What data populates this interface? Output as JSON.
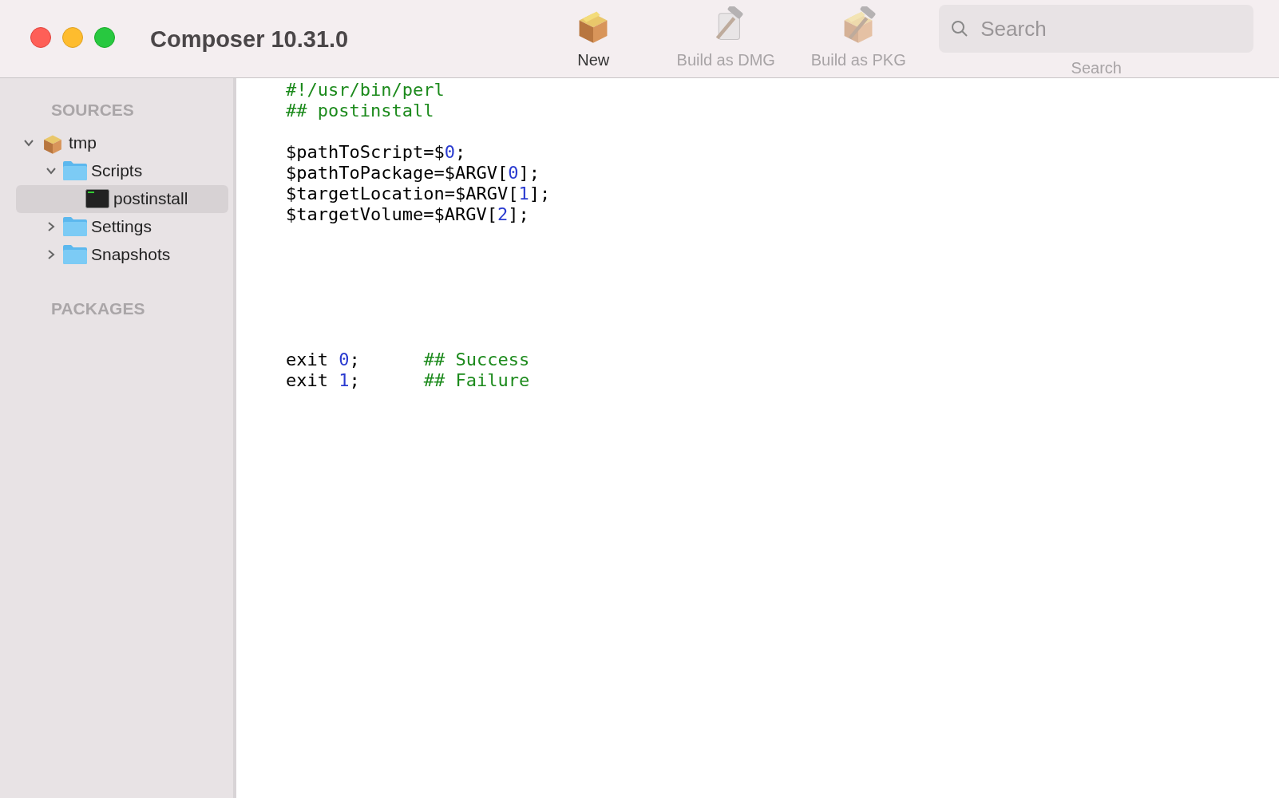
{
  "window": {
    "title": "Composer 10.31.0"
  },
  "toolbar": {
    "items": [
      {
        "kind": "box",
        "label": "New",
        "disabled": false
      },
      {
        "kind": "hammer-disk",
        "label": "Build as DMG",
        "disabled": true
      },
      {
        "kind": "hammer-box",
        "label": "Build as PKG",
        "disabled": true
      }
    ],
    "search": {
      "placeholder": "Search",
      "label": "Search"
    }
  },
  "sidebar": {
    "sections": [
      {
        "title": "SOURCES",
        "items": [
          {
            "kind": "package",
            "label": "tmp",
            "expanded": true,
            "selected": false,
            "children": [
              {
                "kind": "folder",
                "label": "Scripts",
                "expanded": true,
                "selected": false,
                "children": [
                  {
                    "kind": "script",
                    "label": "postinstall",
                    "selected": true
                  }
                ]
              },
              {
                "kind": "folder",
                "label": "Settings",
                "expanded": false,
                "selected": false
              },
              {
                "kind": "folder",
                "label": "Snapshots",
                "expanded": false,
                "selected": false
              }
            ]
          }
        ]
      },
      {
        "title": "PACKAGES"
      }
    ]
  },
  "editor": {
    "lines": [
      {
        "kind": "code",
        "tokens": [
          {
            "kind": "comment",
            "text": "#!/usr/bin/perl"
          }
        ]
      },
      {
        "kind": "code",
        "tokens": [
          {
            "kind": "comment",
            "text": "## postinstall"
          }
        ]
      },
      {
        "kind": "blank"
      },
      {
        "kind": "code",
        "tokens": [
          {
            "kind": "plain",
            "text": "$pathToScript=$"
          },
          {
            "kind": "number",
            "text": "0"
          },
          {
            "kind": "plain",
            "text": ";"
          }
        ]
      },
      {
        "kind": "code",
        "tokens": [
          {
            "kind": "plain",
            "text": "$pathToPackage=$ARGV["
          },
          {
            "kind": "number",
            "text": "0"
          },
          {
            "kind": "plain",
            "text": "];"
          }
        ]
      },
      {
        "kind": "code",
        "tokens": [
          {
            "kind": "plain",
            "text": "$targetLocation=$ARGV["
          },
          {
            "kind": "number",
            "text": "1"
          },
          {
            "kind": "plain",
            "text": "];"
          }
        ]
      },
      {
        "kind": "code",
        "tokens": [
          {
            "kind": "plain",
            "text": "$targetVolume=$ARGV["
          },
          {
            "kind": "number",
            "text": "2"
          },
          {
            "kind": "plain",
            "text": "];"
          }
        ]
      },
      {
        "kind": "blank"
      },
      {
        "kind": "blank"
      },
      {
        "kind": "blank"
      },
      {
        "kind": "blank"
      },
      {
        "kind": "blank"
      },
      {
        "kind": "blank"
      },
      {
        "kind": "code",
        "tokens": [
          {
            "kind": "plain",
            "text": "exit "
          },
          {
            "kind": "number",
            "text": "0"
          },
          {
            "kind": "plain",
            "text": ";"
          },
          {
            "kind": "aligned-comment",
            "text": "## Success"
          }
        ]
      },
      {
        "kind": "code",
        "tokens": [
          {
            "kind": "plain",
            "text": "exit "
          },
          {
            "kind": "number",
            "text": "1"
          },
          {
            "kind": "plain",
            "text": ";"
          },
          {
            "kind": "aligned-comment",
            "text": "## Failure"
          }
        ]
      }
    ]
  }
}
